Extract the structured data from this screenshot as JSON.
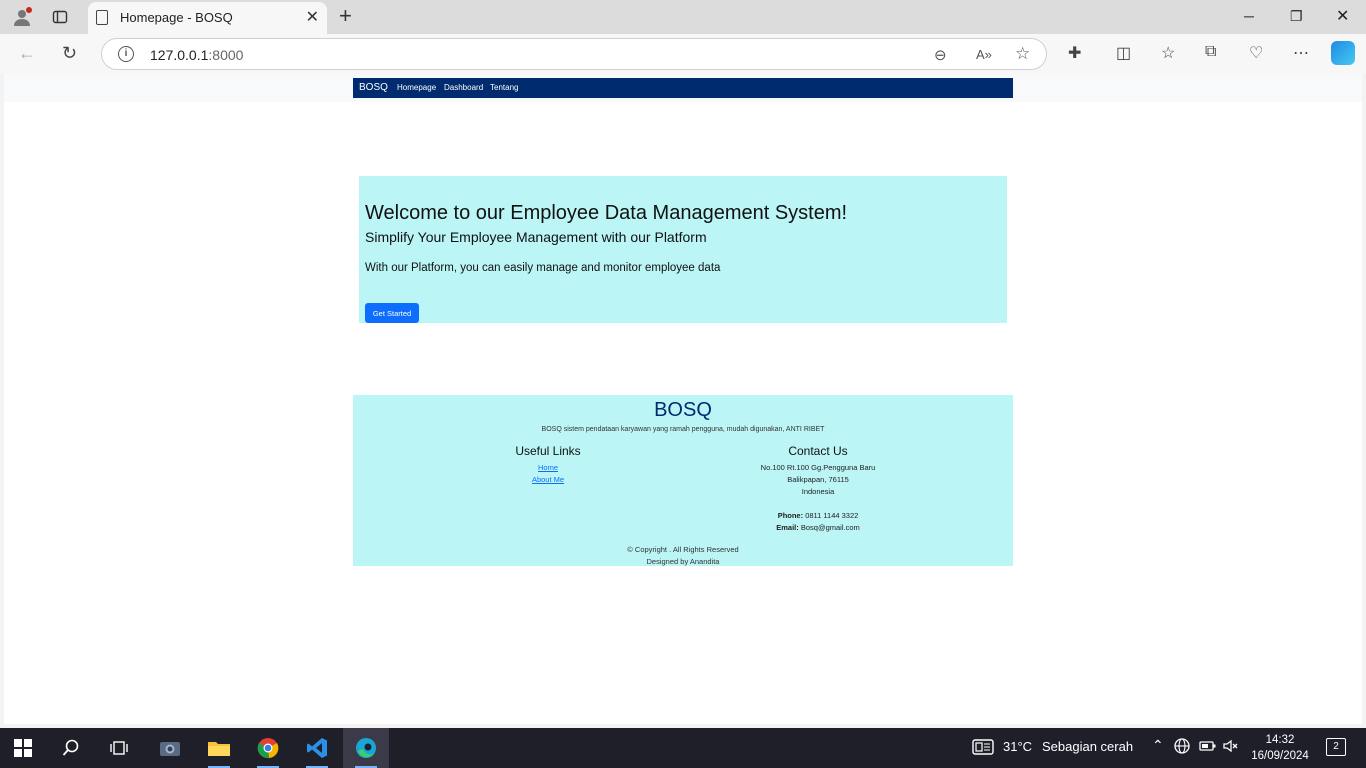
{
  "browser": {
    "tab_title": "Homepage - BOSQ",
    "tab_close": "✕",
    "new_tab": "+",
    "url_host": "127.0.0.1",
    "url_port": ":8000"
  },
  "site": {
    "nav": {
      "brand": "BOSQ",
      "links": [
        "Homepage",
        "Dashboard",
        "Tentang"
      ]
    },
    "hero": {
      "title": "Welcome to our Employee Data Management System!",
      "subtitle": "Simplify Your Employee Management with our Platform",
      "description": "With our Platform, you can easily manage and monitor employee data",
      "cta": "Get Started"
    },
    "footer": {
      "brand": "BOSQ",
      "tagline": "BOSQ sistem pendataan karyawan yang ramah pengguna, mudah digunakan, ANTI RIBET",
      "useful_links_title": "Useful Links",
      "links": [
        "Home",
        "About Me"
      ],
      "contact_title": "Contact Us",
      "address_line1": "No.100 Rt.100 Gg.Pengguna Baru",
      "address_line2": "Balikpapan, 76115",
      "address_line3": "Indonesia",
      "phone_label": "Phone:",
      "phone": "0811 1144 3322",
      "email_label": "Email:",
      "email": "Bosq@gmail.com",
      "copyright": "© Copyright . All Rights Reserved",
      "designed_by": "Designed by Anandita"
    }
  },
  "taskbar": {
    "weather_temp": "31°C",
    "weather_desc": "Sebagian cerah",
    "time": "14:32",
    "date": "16/09/2024",
    "notifications": "2"
  },
  "colors": {
    "nav_bg": "#002b6e",
    "hero_bg": "#bbf5f5",
    "button": "#0d6efd"
  }
}
